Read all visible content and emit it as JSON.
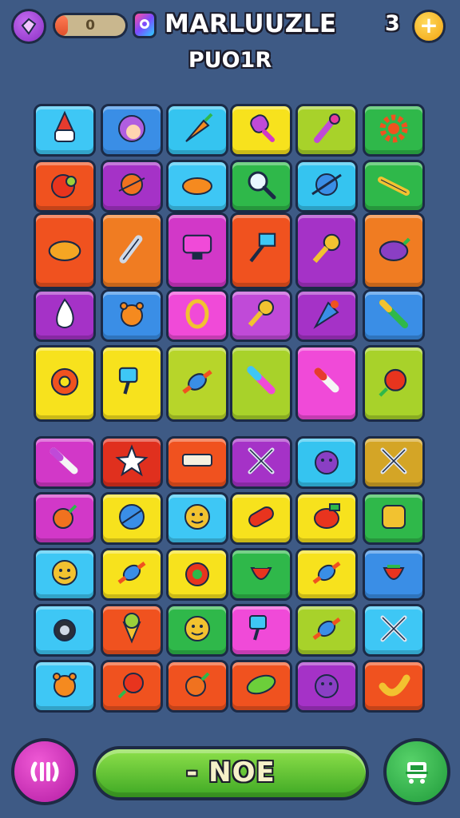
{
  "header": {
    "title": "MARLUUZLE",
    "subtitle": "PUO1R",
    "progress_value": "0",
    "progress_fraction": 0.18,
    "lives_count": "3",
    "plus_label": "+"
  },
  "footer": {
    "action_label": "- NOE"
  },
  "colors": {
    "background": "#3e5a85",
    "border": "#1b2a46"
  },
  "board": {
    "tiles": [
      {
        "color": "#3ec7f5",
        "icon": "gnome-icon"
      },
      {
        "color": "#3a8ee6",
        "icon": "face-icon"
      },
      {
        "color": "#35c4f0",
        "icon": "carrot-icon"
      },
      {
        "color": "#f7e21d",
        "icon": "popsicle-icon"
      },
      {
        "color": "#a8d22a",
        "icon": "brush-icon"
      },
      {
        "color": "#2fb84a",
        "icon": "gear-icon"
      },
      {
        "color": "#f0521f",
        "icon": "tomato-icon"
      },
      {
        "color": "#a532c7",
        "icon": "planet-icon"
      },
      {
        "color": "#3ec7f5",
        "icon": "sweet-potato-icon"
      },
      {
        "color": "#2fb84a",
        "icon": "magnifier-icon"
      },
      {
        "color": "#35c4f0",
        "icon": "planet-ring-icon"
      },
      {
        "color": "#2fb84a",
        "icon": "pencil-icon"
      },
      {
        "color": "#f0521f",
        "icon": "cloud-icon"
      },
      {
        "color": "#f07c22",
        "icon": "rocket-icon"
      },
      {
        "color": "#d238c8",
        "icon": "monitor-icon"
      },
      {
        "color": "#f0521f",
        "icon": "signpost-icon"
      },
      {
        "color": "#a532c7",
        "icon": "key-icon"
      },
      {
        "color": "#f07c22",
        "icon": "eggplant-icon"
      },
      {
        "color": "#a532c7",
        "icon": "drop-icon"
      },
      {
        "color": "#3a8ee6",
        "icon": "bear-icon"
      },
      {
        "color": "#f04ad8",
        "icon": "ring-icon"
      },
      {
        "color": "#c04ad8",
        "icon": "key-icon"
      },
      {
        "color": "#a532c7",
        "icon": "cone-icon"
      },
      {
        "color": "#3a8ee6",
        "icon": "syringe-icon"
      },
      {
        "color": "#f7e21d",
        "icon": "donut-icon"
      },
      {
        "color": "#f7e21d",
        "icon": "paint-icon"
      },
      {
        "color": "#b7d52a",
        "icon": "candy-icon"
      },
      {
        "color": "#a8d22a",
        "icon": "marker-icon"
      },
      {
        "color": "#f04ad8",
        "icon": "lipstick-icon"
      },
      {
        "color": "#a8d22a",
        "icon": "berry-icon"
      },
      {
        "color": "#d238c8",
        "icon": "knife-icon"
      },
      {
        "color": "#e0301e",
        "icon": "star-icon"
      },
      {
        "color": "#f0521f",
        "icon": "ruler-icon"
      },
      {
        "color": "#a532c7",
        "icon": "cross-icon"
      },
      {
        "color": "#35c4f0",
        "icon": "monster-icon"
      },
      {
        "color": "#d4a526",
        "icon": "cross-icon"
      },
      {
        "color": "#d238c8",
        "icon": "radish-icon"
      },
      {
        "color": "#f7e21d",
        "icon": "ball-icon"
      },
      {
        "color": "#3ec7f5",
        "icon": "smile-icon"
      },
      {
        "color": "#f7e21d",
        "icon": "capsule-icon"
      },
      {
        "color": "#f7e21d",
        "icon": "jar-icon"
      },
      {
        "color": "#2fb84a",
        "icon": "toast-icon"
      },
      {
        "color": "#3ec7f5",
        "icon": "smile-icon"
      },
      {
        "color": "#f7e21d",
        "icon": "candy-icon"
      },
      {
        "color": "#f7e21d",
        "icon": "apple-icon"
      },
      {
        "color": "#2fb84a",
        "icon": "strawberry-icon"
      },
      {
        "color": "#f7e21d",
        "icon": "candy-icon"
      },
      {
        "color": "#3a8ee6",
        "icon": "strawberry-icon"
      },
      {
        "color": "#3ec7f5",
        "icon": "bomb-icon"
      },
      {
        "color": "#f0521f",
        "icon": "icecream-icon"
      },
      {
        "color": "#2fb84a",
        "icon": "smile-icon"
      },
      {
        "color": "#f04ad8",
        "icon": "paint-icon"
      },
      {
        "color": "#a8d22a",
        "icon": "candy-icon"
      },
      {
        "color": "#3ec7f5",
        "icon": "cross-icon"
      },
      {
        "color": "#3ec7f5",
        "icon": "bear-icon"
      },
      {
        "color": "#f0521f",
        "icon": "berry-icon"
      },
      {
        "color": "#f0521f",
        "icon": "radish-icon"
      },
      {
        "color": "#f0521f",
        "icon": "leaf-icon"
      },
      {
        "color": "#a532c7",
        "icon": "monster-icon"
      },
      {
        "color": "#f0521f",
        "icon": "banana-icon"
      }
    ]
  }
}
